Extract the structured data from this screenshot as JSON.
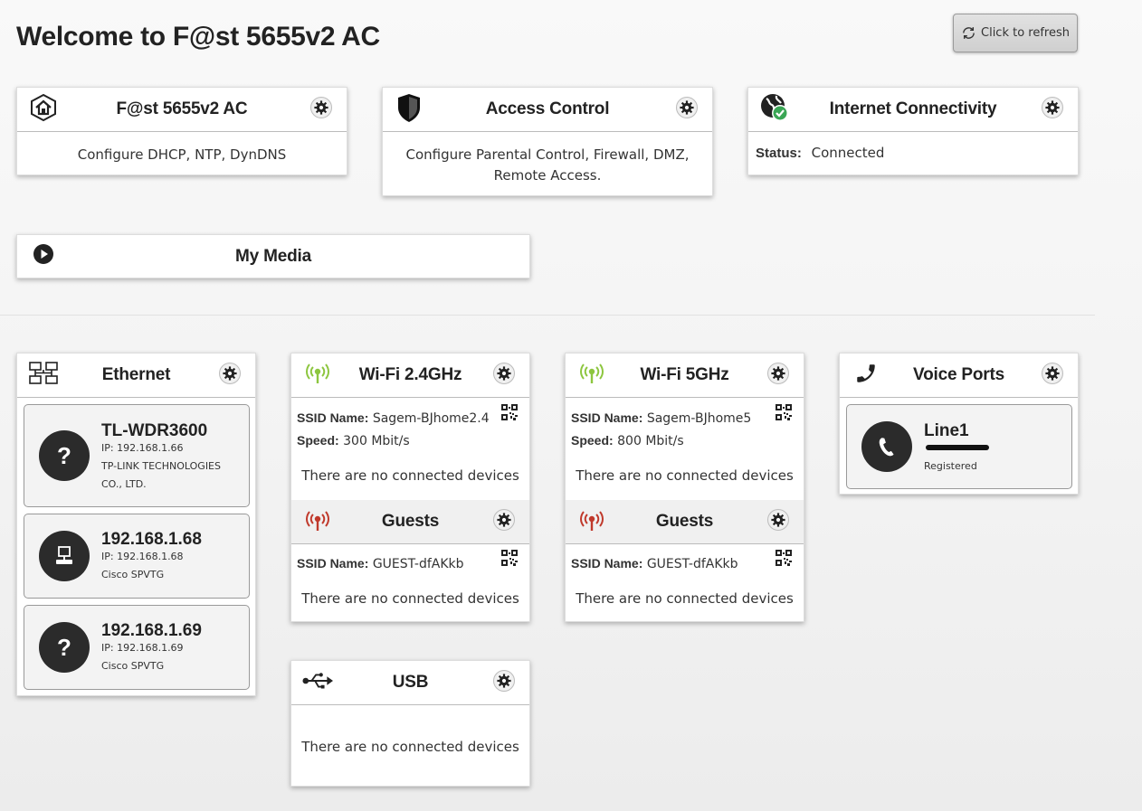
{
  "header": {
    "title": "Welcome to F@st 5655v2 AC",
    "refresh_label": "Click to refresh"
  },
  "cards": {
    "router": {
      "title": "F@st 5655v2 AC",
      "desc": "Configure DHCP, NTP, DynDNS"
    },
    "access": {
      "title": "Access Control",
      "desc_line1": "Configure Parental Control, Firewall, DMZ,",
      "desc_line2": "Remote Access."
    },
    "internet": {
      "title": "Internet Connectivity",
      "status_label": "Status:",
      "status_value": "Connected"
    },
    "media": {
      "title": "My Media"
    }
  },
  "ethernet": {
    "title": "Ethernet",
    "devices": [
      {
        "name": "TL-WDR3600",
        "ip": "IP: 192.168.1.66",
        "vendor_line1": "TP-LINK TECHNOLOGIES",
        "vendor_line2": "CO., LTD.",
        "icon": "question-icon"
      },
      {
        "name": "192.168.1.68",
        "ip": "IP: 192.168.1.68",
        "vendor_line1": "Cisco SPVTG",
        "icon": "computer-icon"
      },
      {
        "name": "192.168.1.69",
        "ip": "IP: 192.168.1.69",
        "vendor_line1": "Cisco SPVTG",
        "icon": "question-icon"
      }
    ]
  },
  "wifi24": {
    "title": "Wi-Fi 2.4GHz",
    "ssid_label": "SSID Name:",
    "ssid": "Sagem-BJhome2.4",
    "speed_label": "Speed:",
    "speed": "300 Mbit/s",
    "no_devices": "There are no connected devices",
    "guests": {
      "title": "Guests",
      "ssid_label": "SSID Name:",
      "ssid": "GUEST-dfAKkb",
      "no_devices": "There are no connected devices"
    }
  },
  "wifi5": {
    "title": "Wi-Fi 5GHz",
    "ssid_label": "SSID Name:",
    "ssid": "Sagem-BJhome5",
    "speed_label": "Speed:",
    "speed": "800 Mbit/s",
    "no_devices": "There are no connected devices",
    "guests": {
      "title": "Guests",
      "ssid_label": "SSID Name:",
      "ssid": "GUEST-dfAKkb",
      "no_devices": "There are no connected devices"
    }
  },
  "voice": {
    "title": "Voice Ports",
    "line": {
      "name": "Line1",
      "status": "Registered"
    }
  },
  "usb": {
    "title": "USB",
    "no_devices": "There are no connected devices"
  },
  "colors": {
    "wifi_on": "#8dc63f",
    "wifi_off": "#c0392b",
    "status_ok": "#3aa655",
    "dark_circle": "#2b2b2b"
  }
}
